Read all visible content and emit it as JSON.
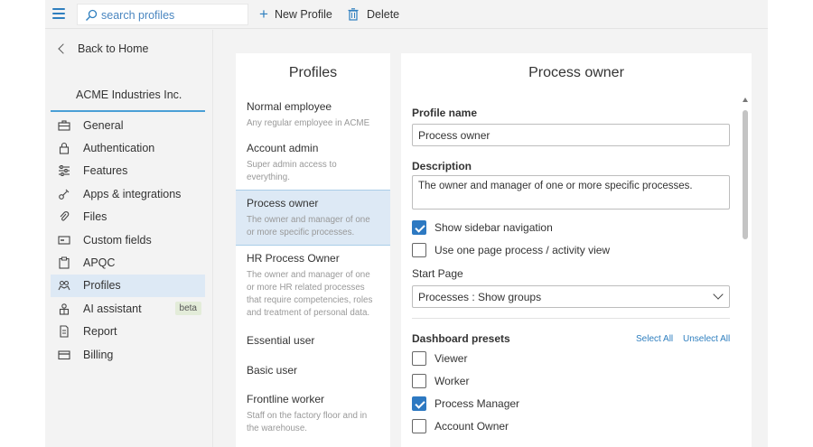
{
  "topbar": {
    "search_placeholder": "search profiles",
    "new_profile_label": "New Profile",
    "delete_label": "Delete"
  },
  "sidebar": {
    "back_label": "Back to Home",
    "org_name": "ACME Industries Inc.",
    "items": [
      {
        "label": "General",
        "icon": "briefcase-icon"
      },
      {
        "label": "Authentication",
        "icon": "lock-icon"
      },
      {
        "label": "Features",
        "icon": "sliders-icon"
      },
      {
        "label": "Apps & integrations",
        "icon": "plug-icon"
      },
      {
        "label": "Files",
        "icon": "paperclip-icon"
      },
      {
        "label": "Custom fields",
        "icon": "field-icon"
      },
      {
        "label": "APQC",
        "icon": "clipboard-icon"
      },
      {
        "label": "Profiles",
        "icon": "people-icon",
        "active": true
      },
      {
        "label": "AI assistant",
        "icon": "robot-icon",
        "badge": "beta"
      },
      {
        "label": "Report",
        "icon": "document-icon"
      },
      {
        "label": "Billing",
        "icon": "card-icon"
      }
    ]
  },
  "profiles_panel": {
    "title": "Profiles",
    "items": [
      {
        "name": "Normal employee",
        "desc": "Any regular employee in ACME"
      },
      {
        "name": "Account admin",
        "desc": "Super admin access to everything."
      },
      {
        "name": "Process owner",
        "desc": "The owner and manager of one or more specific processes.",
        "active": true
      },
      {
        "name": "HR Process Owner",
        "desc": "The owner and manager of one or more HR related processes that require competencies, roles and treatment of personal data."
      },
      {
        "name": "Essential user",
        "desc": ""
      },
      {
        "name": "Basic user",
        "desc": ""
      },
      {
        "name": "Frontline worker",
        "desc": "Staff on the factory floor and in the warehouse."
      }
    ]
  },
  "details": {
    "title": "Process owner",
    "profile_name_label": "Profile name",
    "profile_name_value": "Process owner",
    "description_label": "Description",
    "description_value": "The owner and manager of one or more specific processes.",
    "show_sidebar_label": "Show sidebar navigation",
    "show_sidebar_checked": true,
    "one_page_label": "Use one page process / activity view",
    "one_page_checked": false,
    "start_page_label": "Start Page",
    "start_page_value": "Processes : Show groups",
    "dashboard_label": "Dashboard presets",
    "select_all": "Select All",
    "unselect_all": "Unselect All",
    "presets": [
      {
        "label": "Viewer",
        "checked": false
      },
      {
        "label": "Worker",
        "checked": false
      },
      {
        "label": "Process Manager",
        "checked": true
      },
      {
        "label": "Account Owner",
        "checked": false
      }
    ]
  },
  "colors": {
    "accent": "#2d79c2",
    "selected_bg": "#dde9f5",
    "badge_bg": "#e3ecd9"
  }
}
